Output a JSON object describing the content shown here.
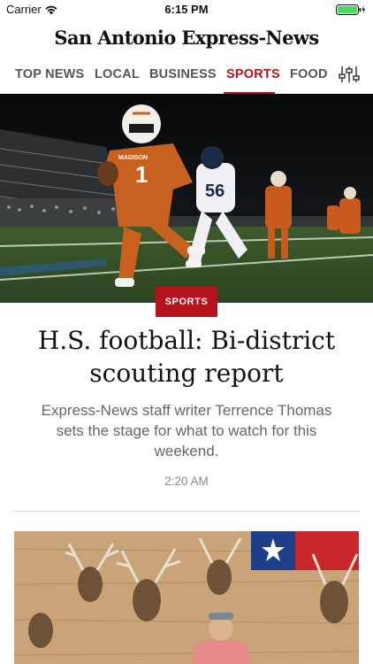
{
  "status_bar": {
    "carrier": "Carrier",
    "time": "6:15 PM",
    "battery_color": "#4cd964"
  },
  "masthead": {
    "logo_text": "San Antonio Express-News"
  },
  "nav": {
    "tabs": [
      {
        "label": "TOP NEWS",
        "active": false
      },
      {
        "label": "LOCAL",
        "active": false
      },
      {
        "label": "BUSINESS",
        "active": false
      },
      {
        "label": "SPORTS",
        "active": true
      },
      {
        "label": "FOOD",
        "active": false
      }
    ],
    "filter_icon": "sliders-icon",
    "accent_color": "#b5121b"
  },
  "articles": [
    {
      "section_badge": "SPORTS",
      "headline": "H.S. football: Bi-district scouting report",
      "summary": "Express-News staff writer Terrence Thomas sets the stage for what to watch for this weekend.",
      "time": "2:20 AM",
      "photo": {
        "jersey_number": "1",
        "jersey_text": "MADISON",
        "opponent_number": "56"
      }
    },
    {
      "photo": {
        "subject": "deer-mounts-photo"
      }
    }
  ]
}
